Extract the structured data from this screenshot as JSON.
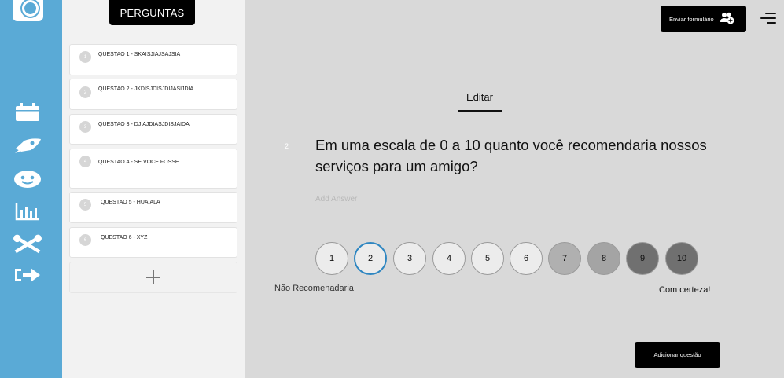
{
  "list": {
    "header": "PERGUNTAS",
    "questions": [
      {
        "num": "1",
        "label": "QUESTAO 1 - SKAISJIAJSAJSIA"
      },
      {
        "num": "2",
        "label": "QUESTAO 2 - JKDISJDISJDIJASIJDIA"
      },
      {
        "num": "3",
        "label": "QUESTAO 3 - DJIAJDIASJDISJAIDA"
      },
      {
        "num": "4",
        "label": "QUESTAO 4 - SE VOCE FOSSE"
      },
      {
        "num": "5",
        "label": "QUESTAO 5 - HUAIALA"
      },
      {
        "num": "6",
        "label": "QUESTAO 6 - XYZ"
      }
    ]
  },
  "header": {
    "send_label": "Enviar formulário"
  },
  "editor": {
    "tab_label": "Editar",
    "question_number": "2",
    "question_text": "Em uma escala de 0 a 10 quanto você recomendaria nossos serviços para um amigo?",
    "answer_placeholder": "Add Answer",
    "scale": [
      "1",
      "2",
      "3",
      "4",
      "5",
      "6",
      "7",
      "8",
      "9",
      "10"
    ],
    "scale_colors": [
      "#ececec",
      "#ececec",
      "#ececec",
      "#ececec",
      "#ececec",
      "#ececec",
      "#b0b0b0",
      "#a4a4a4",
      "#707070",
      "#707070"
    ],
    "selected": "2",
    "label_low": "Não Recomenadaria",
    "label_high": "Com certeza!",
    "add_question_label": "Adicionar questão"
  },
  "colors": {
    "rail": "#5aaad6",
    "selected_ring": "#2e86c1"
  },
  "icons": [
    "calendar-icon",
    "rocket-icon",
    "smiley-icon",
    "bar-chart-icon",
    "tools-icon",
    "logout-arrow-icon",
    "add-people-icon",
    "menu-icon",
    "plus-icon"
  ]
}
